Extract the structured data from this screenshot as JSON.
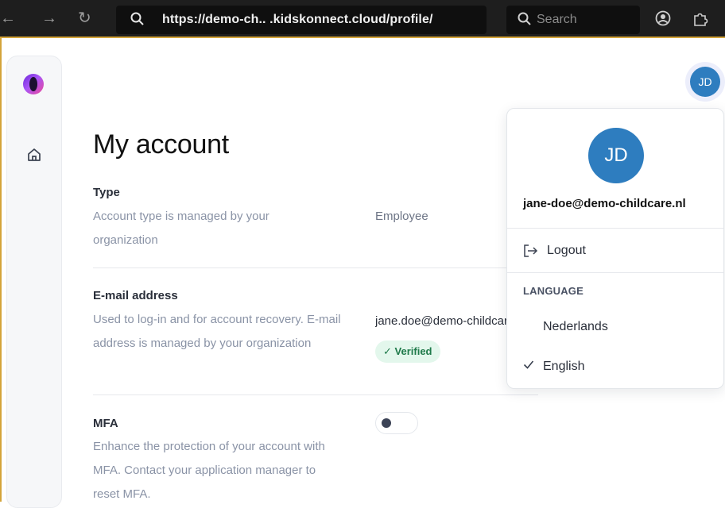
{
  "browser": {
    "url": "https://demo-ch.. .kidskonnect.cloud/profile/",
    "search_placeholder": "Search"
  },
  "page": {
    "title": "My account"
  },
  "sections": {
    "type": {
      "label": "Type",
      "description": "Account type is managed by your organization",
      "value": "Employee"
    },
    "email": {
      "label": "E-mail address",
      "description": "Used to log-in and for account recovery. E-mail address is managed by your organization",
      "value": "jane.doe@demo-childcare.nl",
      "badge": "Verified"
    },
    "mfa": {
      "label": "MFA",
      "description": "Enhance the protection of your account with MFA. Contact your application manager to reset MFA.",
      "enabled": false
    }
  },
  "user": {
    "initials": "JD",
    "email": "jane-doe@demo-childcare.nl"
  },
  "menu": {
    "logout_label": "Logout",
    "language_header": "LANGUAGE",
    "languages": [
      {
        "label": "Nederlands",
        "selected": false
      },
      {
        "label": "English",
        "selected": true
      }
    ]
  },
  "colors": {
    "accent": "#2e7dbf",
    "verified_bg": "#e3f7ec",
    "verified_text": "#1f7a4a",
    "browser_highlight": "#d4a43a"
  }
}
